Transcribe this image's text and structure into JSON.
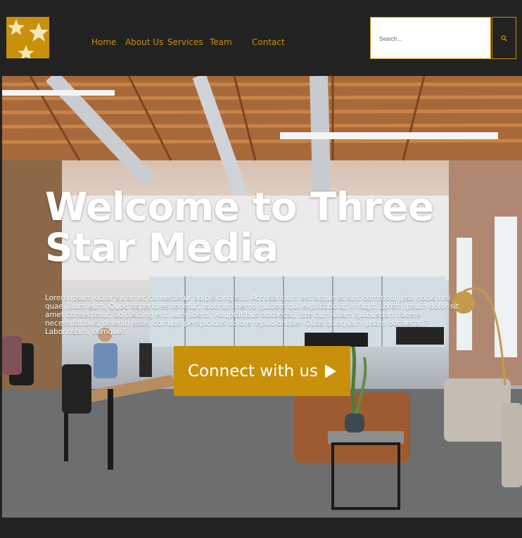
{
  "colors": {
    "accent": "#c8900b",
    "background": "#222222",
    "text_light": "#ffffff"
  },
  "header": {
    "logo_icon": "three-stars-logo",
    "nav": [
      {
        "label": "Home"
      },
      {
        "label": "About Us"
      },
      {
        "label": "Services"
      },
      {
        "label": "Team"
      },
      {
        "label": "Contact"
      }
    ],
    "search": {
      "placeholder": "Search...",
      "icon": "search-icon"
    }
  },
  "hero": {
    "title": "Welcome to Three Star Media",
    "body": "Lorem ipsum dolor sit amet consectetur adipisicing elit. Accusantium est atque et sint commodi ipsa nobis nisi quae, illum eum. Quod asperiores tenetur, laborum nemo quidem qui explicabo at in fugit. Lorem ipsum dolor sit amet consectetur, adipisicing elit. Iure libero, voluptatibus obcaecati iste cum ullam quibusdam facere necessitatibus, deleniti esse, corrupti perspiciatis dolore repudiandae! Quas quisquam ipsam obcaecati? Laboriosam, cumque?",
    "cta_label": "Connect with us",
    "cta_icon": "play-icon",
    "background_image": "open-office-photo"
  }
}
